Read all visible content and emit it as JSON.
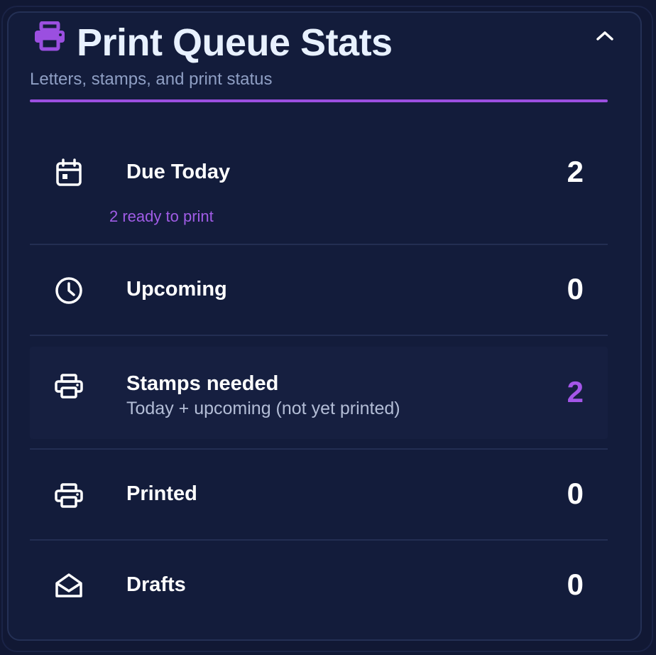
{
  "header": {
    "title": "Print Queue Stats",
    "subtitle": "Letters, stamps, and print status",
    "title_icon": "printer-icon",
    "collapse_icon": "chevron-up-icon"
  },
  "colors": {
    "accent": "#9b4fe0",
    "background": "#131c3b",
    "text": "#ffffff",
    "muted": "#8f9fc4"
  },
  "stats": [
    {
      "icon": "calendar-icon",
      "label": "Due Today",
      "value": "2",
      "note": "2 ready to print"
    },
    {
      "icon": "clock-icon",
      "label": "Upcoming",
      "value": "0"
    },
    {
      "icon": "printer-icon",
      "label": "Stamps needed",
      "sublabel": "Today + upcoming (not yet printed)",
      "value": "2",
      "highlight": true
    },
    {
      "icon": "printer-icon",
      "label": "Printed",
      "value": "0"
    },
    {
      "icon": "envelope-open-icon",
      "label": "Drafts",
      "value": "0"
    }
  ]
}
